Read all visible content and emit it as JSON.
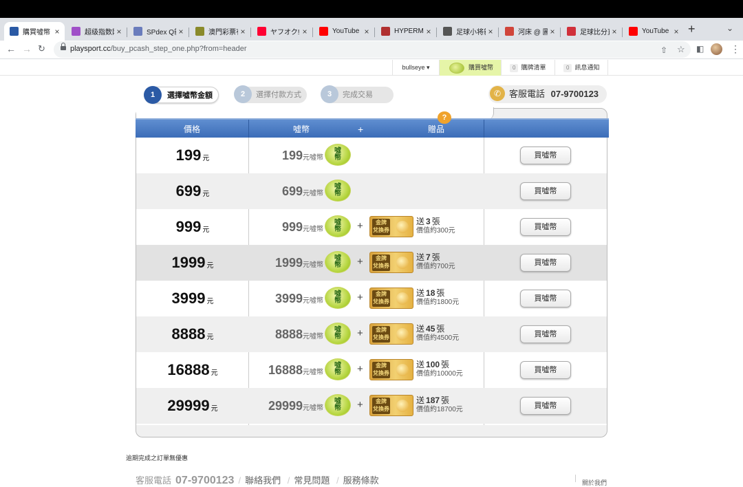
{
  "browser": {
    "tabs": [
      {
        "title": "購買噓幣",
        "icon": "playsport-icon",
        "color": "#2b5aa5",
        "active": true
      },
      {
        "title": "超级指数网",
        "icon": "s-icon",
        "color": "#a050c8"
      },
      {
        "title": "SPdex Q新",
        "icon": "s-icon",
        "color": "#6a7cbc"
      },
      {
        "title": "澳門彩票有",
        "icon": "macau-icon",
        "color": "#8a8a2a"
      },
      {
        "title": "ヤフオク!",
        "icon": "yahoo-icon",
        "color": "#ff0033"
      },
      {
        "title": "YouTube",
        "icon": "youtube-icon",
        "color": "#ff0000"
      },
      {
        "title": "HYPERMO",
        "icon": "hypermo-icon",
        "color": "#b03030"
      },
      {
        "title": "足球小将新",
        "icon": "globe-icon",
        "color": "#555555"
      },
      {
        "title": "河床 @ 圖",
        "icon": "riverbed-icon",
        "color": "#d0453a"
      },
      {
        "title": "足球比分直",
        "icon": "score-icon",
        "color": "#d0303a"
      },
      {
        "title": "YouTube",
        "icon": "youtube-icon",
        "color": "#ff0000"
      }
    ],
    "url_host": "playsport.cc",
    "url_path": "/buy_pcash_step_one.php?from=header"
  },
  "sitebar": {
    "user": "bullseye ▾",
    "buy_coins": "購買噓幣",
    "cart_count": "0",
    "cart": "購牌清單",
    "msg_count": "0",
    "messages": "訊息通知"
  },
  "steps": [
    {
      "num": "1",
      "label": "選擇噓幣金額"
    },
    {
      "num": "2",
      "label": "選擇付款方式"
    },
    {
      "num": "3",
      "label": "完成交易"
    }
  ],
  "service": {
    "label": "客服電話",
    "phone": "07-9700123"
  },
  "table": {
    "headers": {
      "price": "價格",
      "coins": "噓幣",
      "plus": "+",
      "gift": "贈品",
      "help": "?"
    },
    "unit": "元",
    "coin_unit": "元噓幣",
    "coin_logo": "噓\n幣",
    "ticket_label": "金牌\n兌換券",
    "plus": "+",
    "buy_label": "買噓幣",
    "rows": [
      {
        "price": "199",
        "coins": "199",
        "gift": null
      },
      {
        "price": "699",
        "coins": "699",
        "gift": null
      },
      {
        "price": "999",
        "coins": "999",
        "gift": {
          "line1a": "送",
          "count": "3",
          "line1b": "張",
          "line2": "價值約300元"
        }
      },
      {
        "price": "1999",
        "coins": "1999",
        "gift": {
          "line1a": "送",
          "count": "7",
          "line1b": "張",
          "line2": "價值約700元"
        }
      },
      {
        "price": "3999",
        "coins": "3999",
        "gift": {
          "line1a": "送",
          "count": "18",
          "line1b": "張",
          "line2": "價值約1800元"
        }
      },
      {
        "price": "8888",
        "coins": "8888",
        "gift": {
          "line1a": "送",
          "count": "45",
          "line1b": "張",
          "line2": "價值約4500元"
        }
      },
      {
        "price": "16888",
        "coins": "16888",
        "gift": {
          "line1a": "送",
          "count": "100",
          "line1b": "張",
          "line2": "價值約10000元"
        }
      },
      {
        "price": "29999",
        "coins": "29999",
        "gift": {
          "line1a": "送",
          "count": "187",
          "line1b": "張",
          "line2": "價值約18700元"
        }
      }
    ]
  },
  "note": "逾期完成之訂單無優惠",
  "footer": {
    "label": "客服電話",
    "phone": "07-9700123",
    "links": [
      "聯絡我們",
      "常見問題",
      "服務條款"
    ],
    "right": "關於我們"
  }
}
